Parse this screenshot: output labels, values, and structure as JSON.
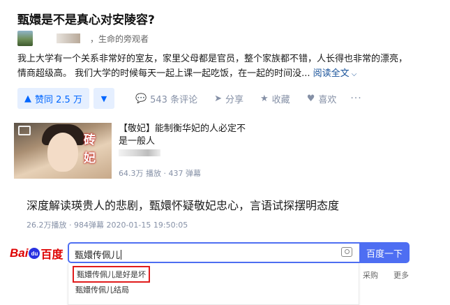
{
  "question": {
    "title": "甄嬛是不是真心对安陵容?"
  },
  "author": {
    "bio": "，生命的旁观者"
  },
  "answer": {
    "lines": [
      "我上大学有一个关系非常好的室友，家里父母都是官员，整个家族都不错，人长得也非常的漂亮，",
      "情商超级高。 我们大学的时候每天一起上课一起吃饭，在一起的时间没..."
    ],
    "read_more": "阅读全文"
  },
  "actions": {
    "upvote": "赞同 2.5 万",
    "comments": "543 条评论",
    "share": "分享",
    "favorite": "收藏",
    "like": "喜欢",
    "more": "···"
  },
  "video1": {
    "thumb_chars": "砖妃",
    "title": "【敬妃】能制衡华妃的人必定不是一般人",
    "meta": "64.3万 播放 · 437 弹幕"
  },
  "video2": {
    "title": "深度解读瑛贵人的悲剧，甄嬛怀疑敬妃忠心，言语试探摆明态度",
    "meta": "26.2万播放 · 984弹幕    2020-01-15 19:50:05"
  },
  "baidu": {
    "logo_bai": "Bai",
    "logo_paw": "du",
    "logo_du": "百度",
    "query": "甄嬛传佩儿",
    "button": "百度一下",
    "suggestions": [
      "甄嬛传佩儿是好是坏",
      "甄嬛传佩儿结局"
    ],
    "side_links": [
      "采购",
      "更多"
    ]
  },
  "colors": {
    "accent": "#0066ff",
    "baidu_blue": "#4e6ef2",
    "highlight_red": "#e01b1b"
  }
}
